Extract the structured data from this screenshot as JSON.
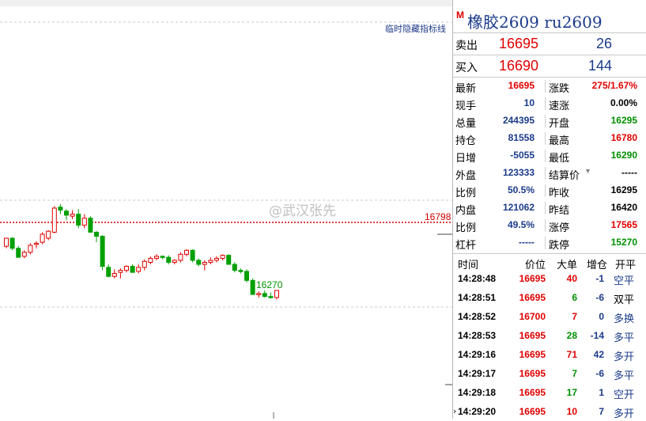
{
  "chart": {
    "hide_indicator_label": "临时隐藏指标线",
    "ref_price_label": "16798",
    "low_label": "16270",
    "candles": [
      [
        16560,
        16640,
        16540,
        16640
      ],
      [
        16640,
        16650,
        16520,
        16540
      ],
      [
        16540,
        16560,
        16450,
        16450
      ],
      [
        16460,
        16520,
        16440,
        16500
      ],
      [
        16500,
        16590,
        16480,
        16570
      ],
      [
        16580,
        16610,
        16540,
        16590
      ],
      [
        16600,
        16700,
        16580,
        16680
      ],
      [
        16640,
        16720,
        16620,
        16710
      ],
      [
        16700,
        16960,
        16690,
        16940
      ],
      [
        16950,
        16980,
        16880,
        16920
      ],
      [
        16910,
        16930,
        16820,
        16870
      ],
      [
        16860,
        16920,
        16830,
        16880
      ],
      [
        16880,
        16930,
        16740,
        16770
      ],
      [
        16770,
        16880,
        16740,
        16840
      ],
      [
        16840,
        16860,
        16700,
        16700
      ],
      [
        16700,
        16710,
        16600,
        16660
      ],
      [
        16660,
        16670,
        16320,
        16360
      ],
      [
        16350,
        16380,
        16250,
        16260
      ],
      [
        16260,
        16330,
        16240,
        16290
      ],
      [
        16300,
        16340,
        16240,
        16320
      ],
      [
        16320,
        16370,
        16300,
        16360
      ],
      [
        16360,
        16380,
        16300,
        16300
      ],
      [
        16310,
        16380,
        16290,
        16350
      ],
      [
        16350,
        16430,
        16320,
        16410
      ],
      [
        16400,
        16460,
        16380,
        16440
      ],
      [
        16440,
        16480,
        16420,
        16460
      ],
      [
        16460,
        16470,
        16430,
        16450
      ],
      [
        16450,
        16470,
        16380,
        16400
      ],
      [
        16400,
        16430,
        16380,
        16420
      ],
      [
        16420,
        16500,
        16400,
        16480
      ],
      [
        16480,
        16530,
        16460,
        16520
      ],
      [
        16520,
        16530,
        16400,
        16420
      ],
      [
        16420,
        16440,
        16360,
        16380
      ],
      [
        16380,
        16420,
        16320,
        16400
      ],
      [
        16400,
        16450,
        16380,
        16420
      ],
      [
        16420,
        16460,
        16400,
        16440
      ],
      [
        16440,
        16480,
        16420,
        16470
      ],
      [
        16470,
        16480,
        16380,
        16380
      ],
      [
        16380,
        16400,
        16300,
        16320
      ],
      [
        16320,
        16340,
        16290,
        16310
      ],
      [
        16310,
        16330,
        16200,
        16220
      ],
      [
        16220,
        16240,
        16080,
        16080
      ],
      [
        16080,
        16110,
        16050,
        16090
      ],
      [
        16090,
        16120,
        16050,
        16060
      ],
      [
        16060,
        16100,
        16040,
        16050
      ],
      [
        16050,
        16120,
        16030,
        16120
      ]
    ]
  },
  "watermark": "@武汉张先",
  "panel": {
    "marker": "M",
    "title": "橡胶2609  ru2609",
    "sell": {
      "label": "卖出",
      "price": "16695",
      "volume": "26"
    },
    "buy": {
      "label": "买入",
      "price": "16690",
      "volume": "144"
    },
    "quote_rows": [
      {
        "l1": "最新",
        "v1": "16695",
        "c1": "red",
        "l2": "涨跌",
        "v2": "275/1.67%",
        "c2": "red"
      },
      {
        "l1": "现手",
        "v1": "10",
        "c1": "blue",
        "l2": "速涨",
        "v2": "0.00%",
        "c2": "black"
      },
      {
        "l1": "总量",
        "v1": "244395",
        "c1": "blue",
        "l2": "开盘",
        "v2": "16295",
        "c2": "green"
      },
      {
        "l1": "持仓",
        "v1": "81558",
        "c1": "blue",
        "l2": "最高",
        "v2": "16780",
        "c2": "red"
      },
      {
        "l1": "日增",
        "v1": "-5055",
        "c1": "blue",
        "l2": "最低",
        "v2": "16290",
        "c2": "green"
      },
      {
        "l1": "外盘",
        "v1": "123333",
        "c1": "blue",
        "l2": "结算价",
        "v2": "-----",
        "c2": "black"
      },
      {
        "l1": "比例",
        "v1": "50.5%",
        "c1": "blue",
        "l2": "昨收",
        "v2": "16295",
        "c2": "black"
      },
      {
        "l1": "内盘",
        "v1": "121062",
        "c1": "blue",
        "l2": "昨结",
        "v2": "16420",
        "c2": "black"
      },
      {
        "l1": "比例",
        "v1": "49.5%",
        "c1": "blue",
        "l2": "涨停",
        "v2": "17565",
        "c2": "red"
      },
      {
        "l1": "杠杆",
        "v1": "-----",
        "c1": "blue",
        "l2": "跌停",
        "v2": "15270",
        "c2": "green"
      }
    ],
    "trade_header": {
      "time": "时间",
      "price": "价位",
      "size": "大单",
      "oi": "增仓",
      "kind": "开平"
    },
    "trades": [
      {
        "time": "14:28:48",
        "price": "16695",
        "size": "40",
        "sc": "red",
        "oi": "-1",
        "kind": "空平",
        "kc": "blue"
      },
      {
        "time": "14:28:51",
        "price": "16695",
        "size": "6",
        "sc": "green",
        "oi": "-6",
        "kind": "双平",
        "kc": "black"
      },
      {
        "time": "14:28:52",
        "price": "16700",
        "size": "7",
        "sc": "red",
        "oi": "0",
        "kind": "多换",
        "kc": "blue"
      },
      {
        "time": "14:28:53",
        "price": "16695",
        "size": "28",
        "sc": "green",
        "oi": "-14",
        "kind": "多平",
        "kc": "blue"
      },
      {
        "time": "14:29:16",
        "price": "16695",
        "size": "71",
        "sc": "red",
        "oi": "42",
        "kind": "多开",
        "kc": "blue"
      },
      {
        "time": "14:29:17",
        "price": "16695",
        "size": "7",
        "sc": "green",
        "oi": "-6",
        "kind": "多平",
        "kc": "blue"
      },
      {
        "time": "14:29:18",
        "price": "16695",
        "size": "17",
        "sc": "green",
        "oi": "1",
        "kind": "空开",
        "kc": "blue"
      },
      {
        "time": "14:29:20",
        "price": "16695",
        "size": "10",
        "sc": "red",
        "oi": "7",
        "kind": "多开",
        "kc": "blue"
      }
    ]
  },
  "colors": {
    "up": "#e00000",
    "down": "#00a000",
    "ref_line": "#d00000",
    "accent": "#1a3a8a"
  }
}
